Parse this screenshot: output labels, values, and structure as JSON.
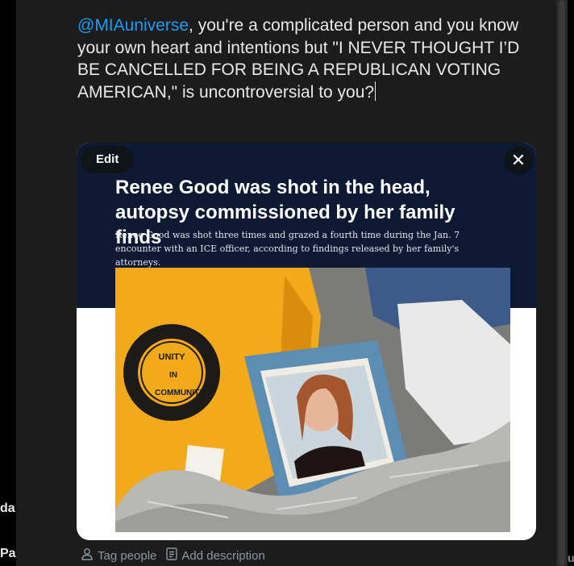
{
  "compose": {
    "mention": "@MIAuniverse",
    "body": ", you're a complicated person and you know your own heart and intentions but \"I NEVER THOUGHT I’D BE CANCELLED FOR BEING A REPUBLICAN VOTING AMERICAN,\" is uncontroversial to you?"
  },
  "media": {
    "edit_label": "Edit",
    "close_icon": "✕",
    "headline": "Renee Good was shot in the head, autopsy commissioned by her family finds",
    "subhead": "Renee Good was shot three times and grazed a fourth time during the Jan. 7 encounter with an ICE officer, according to findings released by her family's attorneys.",
    "shirt_text_top": "UNITY",
    "shirt_text_mid": "IN",
    "shirt_text_bot": "COMMUNITY"
  },
  "actions": {
    "tag_people": "Tag people",
    "add_description": "Add description"
  },
  "background": {
    "left_label_1": "da",
    "left_label_2": "Pa",
    "right_label_1": "u"
  },
  "colors": {
    "accent": "#1d9bf0",
    "modal_bg": "#1c1c1c",
    "article_header_bg": "#0e1a33"
  }
}
